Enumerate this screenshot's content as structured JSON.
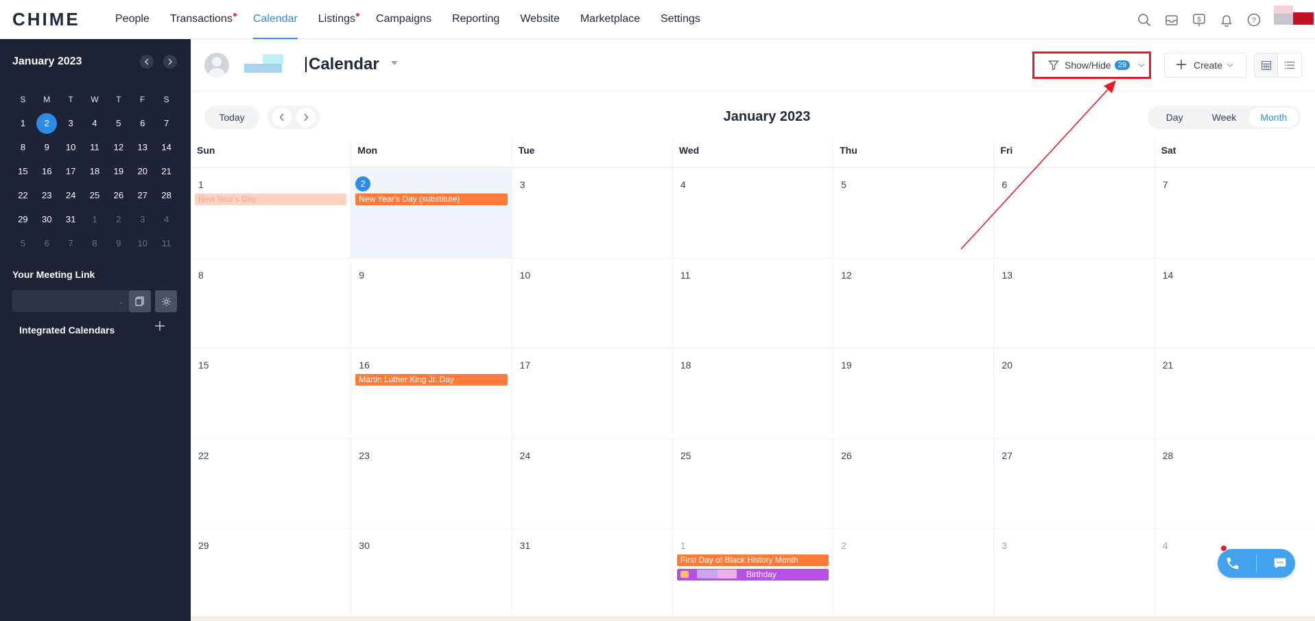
{
  "brand": {
    "logo": "CHIME"
  },
  "nav": {
    "items": [
      {
        "label": "People",
        "dot": false,
        "active": false
      },
      {
        "label": "Transactions",
        "dot": true,
        "active": false
      },
      {
        "label": "Calendar",
        "dot": false,
        "active": true
      },
      {
        "label": "Listings",
        "dot": true,
        "active": false
      },
      {
        "label": "Campaigns",
        "dot": false,
        "active": false
      },
      {
        "label": "Reporting",
        "dot": false,
        "active": false
      },
      {
        "label": "Website",
        "dot": false,
        "active": false
      },
      {
        "label": "Marketplace",
        "dot": false,
        "active": false
      },
      {
        "label": "Settings",
        "dot": false,
        "active": false
      }
    ],
    "icons": [
      "search-icon",
      "inbox-icon",
      "dollar-icon",
      "bell-icon",
      "help-icon"
    ]
  },
  "sidebar": {
    "mini_title": "January 2023",
    "weekdays": [
      "S",
      "M",
      "T",
      "W",
      "T",
      "F",
      "S"
    ],
    "weeks": [
      [
        [
          "1",
          0
        ],
        [
          "2",
          2
        ],
        [
          "3",
          0
        ],
        [
          "4",
          0
        ],
        [
          "5",
          0
        ],
        [
          "6",
          0
        ],
        [
          "7",
          0
        ]
      ],
      [
        [
          "8",
          0
        ],
        [
          "9",
          0
        ],
        [
          "10",
          0
        ],
        [
          "11",
          0
        ],
        [
          "12",
          0
        ],
        [
          "13",
          0
        ],
        [
          "14",
          0
        ]
      ],
      [
        [
          "15",
          0
        ],
        [
          "16",
          0
        ],
        [
          "17",
          0
        ],
        [
          "18",
          0
        ],
        [
          "19",
          0
        ],
        [
          "20",
          0
        ],
        [
          "21",
          0
        ]
      ],
      [
        [
          "22",
          0
        ],
        [
          "23",
          0
        ],
        [
          "24",
          0
        ],
        [
          "25",
          0
        ],
        [
          "26",
          0
        ],
        [
          "27",
          0
        ],
        [
          "28",
          0
        ]
      ],
      [
        [
          "29",
          0
        ],
        [
          "30",
          0
        ],
        [
          "31",
          0
        ],
        [
          "1",
          1
        ],
        [
          "2",
          1
        ],
        [
          "3",
          1
        ],
        [
          "4",
          1
        ]
      ],
      [
        [
          "5",
          1
        ],
        [
          "6",
          1
        ],
        [
          "7",
          1
        ],
        [
          "8",
          1
        ],
        [
          "9",
          1
        ],
        [
          "10",
          1
        ],
        [
          "11",
          1
        ]
      ]
    ],
    "meeting_link_title": "Your Meeting Link",
    "meeting_link_value": ".",
    "integrated_calendars": "Integrated Calendars"
  },
  "header": {
    "title": "Calendar",
    "showhide_label": "Show/Hide",
    "showhide_count": "29",
    "create_label": "Create"
  },
  "toolbar": {
    "today_label": "Today",
    "month_title": "January 2023",
    "views": [
      {
        "label": "Day",
        "active": false
      },
      {
        "label": "Week",
        "active": false
      },
      {
        "label": "Month",
        "active": true
      }
    ]
  },
  "calendar": {
    "dow": [
      "Sun",
      "Mon",
      "Tue",
      "Wed",
      "Thu",
      "Fri",
      "Sat"
    ],
    "weeks": [
      [
        {
          "d": "1",
          "events": [
            {
              "title": "New Year's Day",
              "style": "faded"
            }
          ]
        },
        {
          "d": "2",
          "today": true,
          "events": [
            {
              "title": "New Year's Day (substitute)",
              "style": "orange"
            }
          ]
        },
        {
          "d": "3"
        },
        {
          "d": "4"
        },
        {
          "d": "5"
        },
        {
          "d": "6"
        },
        {
          "d": "7"
        }
      ],
      [
        {
          "d": "8"
        },
        {
          "d": "9"
        },
        {
          "d": "10"
        },
        {
          "d": "11"
        },
        {
          "d": "12"
        },
        {
          "d": "13"
        },
        {
          "d": "14"
        }
      ],
      [
        {
          "d": "15"
        },
        {
          "d": "16",
          "events": [
            {
              "title": "Martin Luther King Jr. Day",
              "style": "orange"
            }
          ]
        },
        {
          "d": "17"
        },
        {
          "d": "18"
        },
        {
          "d": "19"
        },
        {
          "d": "20"
        },
        {
          "d": "21"
        }
      ],
      [
        {
          "d": "22"
        },
        {
          "d": "23"
        },
        {
          "d": "24"
        },
        {
          "d": "25"
        },
        {
          "d": "26"
        },
        {
          "d": "27"
        },
        {
          "d": "28"
        }
      ],
      [
        {
          "d": "29"
        },
        {
          "d": "30"
        },
        {
          "d": "31"
        },
        {
          "d": "1",
          "dim": true,
          "events": [
            {
              "title": "First Day of Black History Month",
              "style": "orange"
            },
            {
              "title": "Birthday",
              "style": "purple",
              "birthday": true
            }
          ]
        },
        {
          "d": "2",
          "dim": true
        },
        {
          "d": "3",
          "dim": true
        },
        {
          "d": "4",
          "dim": true
        }
      ]
    ]
  },
  "colors": {
    "accent": "#2f8be6",
    "sidebar_bg": "#1e2235",
    "event_orange": "#ff7b3a",
    "event_purple": "#b84fe6",
    "highlight_box": "#e11d2a"
  }
}
